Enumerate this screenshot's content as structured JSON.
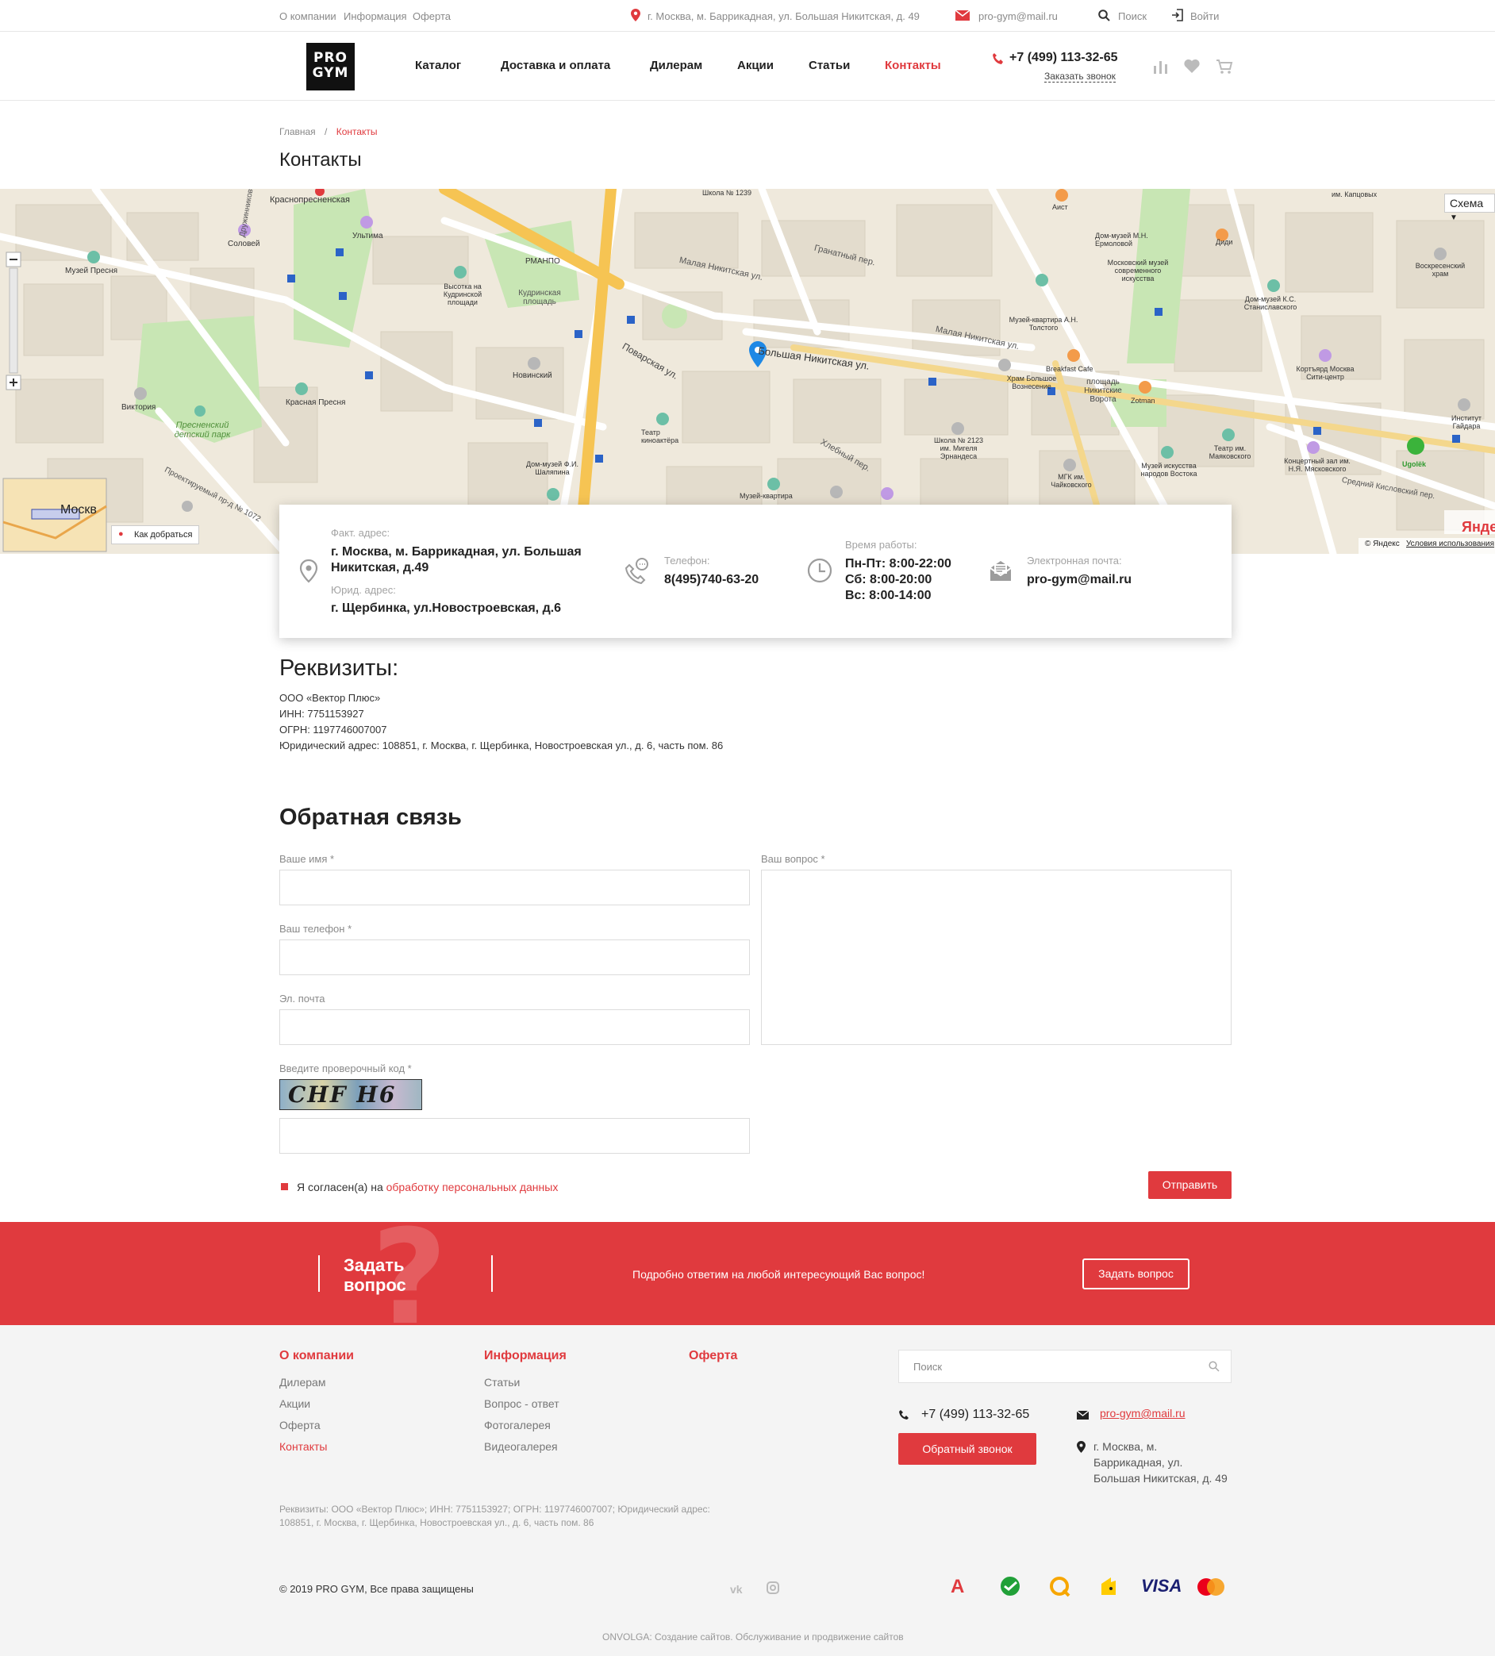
{
  "topbar": {
    "links": [
      "О компании",
      "Информация",
      "Оферта"
    ],
    "address": "г. Москва, м. Баррикадная, ул. Большая Никитская, д. 49",
    "email": "pro-gym@mail.ru",
    "search": "Поиск",
    "login": "Войти"
  },
  "header": {
    "logo_line1": "PRO",
    "logo_line2": "GYM",
    "nav": [
      "Каталог",
      "Доставка и оплата",
      "Дилерам",
      "Акции",
      "Статьи",
      "Контакты"
    ],
    "phone": "+7 (499) 113-32-65",
    "callback": "Заказать звонок"
  },
  "breadcrumb": {
    "home": "Главная",
    "sep": "/",
    "current": "Контакты"
  },
  "page_title": "Контакты",
  "map": {
    "scheme_button": "Схема",
    "route_label": "Как добраться",
    "minimap_label": "Москв",
    "copyright": "© Яндекс",
    "terms": "Условия использования",
    "yandex_logo": "Яндекс",
    "labels": {
      "street1": "Малая Никитская ул.",
      "street2": "Большая Никитская ул.",
      "street3": "Поварская ул.",
      "street4": "Гранатный пер.",
      "street5": "Хлебный пер.",
      "street6": "Малая Никитская ул.",
      "poi1": "Краснопресненская",
      "poi2": "Соловей",
      "poi3": "Музей Пресня",
      "poi4": "Ультима",
      "poi5": "Высотка на Кудринской площади",
      "poi6": "Кудринская площадь",
      "poi7": "РМАНПО",
      "poi8": "Новинский",
      "poi9": "Красная Пресня",
      "poi10": "Виктория",
      "poi11": "Пресненский детский парк",
      "poi12": "Театр киноактёра",
      "poi13": "Дом-музей Ф.И. Шаляпина",
      "poi14": "Музей-квартира А.Н. Толстого",
      "poi15": "Храм Большое Вознесение",
      "poi16": "Breakfast Cafe",
      "poi17": "площадь Никитские Ворота",
      "poi18": "Zotman",
      "poi19": "Дом-музей М.Н. Ермоловой",
      "poi20": "Московский музей современного искусства",
      "poi21": "Диди",
      "poi22": "Аист",
      "poi23": "Дом-музей К.С. Станиславского",
      "poi24": "Воскресенский храм",
      "poi25": "Кортъярд Москва Сити-центр",
      "poi26": "Институт Гайдара",
      "poi27": "Ugolёk",
      "poi28": "Театр им. Маяковского",
      "poi29": "Концертный зал им. Н.Я. Мясковского",
      "poi30": "Музей искусства народов Востока",
      "poi31": "МГК им. Чайковского",
      "poi32": "Школа № 2123 им. Мигеля Эрнандеса",
      "poi33": "Школа № 1239",
      "poi34": "Музей-квартира",
      "poi35": "им. Капцовых",
      "poi36": "Средний Кисловский пер.",
      "poi37": "Проектируемый пр-д № 1072",
      "poi38": "Дружинниковская ул."
    }
  },
  "contacts": {
    "fact_label": "Факт. адрес:",
    "fact_value": "г. Москва, м. Баррикадная, ул. Большая Никитская, д.49",
    "jur_label": "Юрид. адрес:",
    "jur_value": "г. Щербинка, ул.Новостроевская, д.6",
    "phone_label": "Телефон:",
    "phone_value": "8(495)740-63-20",
    "hours_label": "Время работы:",
    "hours": [
      "Пн-Пт: 8:00-22:00",
      "Сб: 8:00-20:00",
      "Вс: 8:00-14:00"
    ],
    "email_label": "Электронная почта:",
    "email_value": "pro-gym@mail.ru"
  },
  "requisites": {
    "title": "Реквизиты:",
    "lines": [
      "ООО «Вектор Плюс»",
      "ИНН: 7751153927",
      "ОГРН: 1197746007007",
      "Юридический адрес: 108851, г. Москва, г. Щербинка, Новостроевская ул., д. 6, часть пом. 86"
    ]
  },
  "feedback": {
    "title": "Обратная связь",
    "name_label": "Ваше имя *",
    "phone_label": "Ваш телефон *",
    "email_label": "Эл. почта",
    "question_label": "Ваш вопрос *",
    "captcha_label": "Введите проверочный код *",
    "captcha_text": "CHF H6",
    "agree_text": "Я согласен(а) на",
    "agree_link": "обработку персональных данных",
    "submit": "Отправить"
  },
  "banner": {
    "title_line1": "Задать",
    "title_line2": "вопрос",
    "text": "Подробно ответим на любой интересующий Вас вопрос!",
    "button": "Задать вопрос"
  },
  "footer": {
    "col1_title": "О компании",
    "col1_links": [
      "Дилерам",
      "Акции",
      "Оферта",
      "Контакты"
    ],
    "col2_title": "Информация",
    "col2_links": [
      "Статьи",
      "Вопрос - ответ",
      "Фотогалерея",
      "Видеогалерея"
    ],
    "col3_title": "Оферта",
    "search_placeholder": "Поиск",
    "phone": "+7 (499) 113-32-65",
    "callback_button": "Обратный звонок",
    "email": "pro-gym@mail.ru",
    "address": "г. Москва, м. Баррикадная, ул. Большая Никитская, д. 49",
    "requisites": "Реквизиты: ООО «Вектор Плюс»; ИНН: 7751153927; ОГРН: 1197746007007; Юридический адрес: 108851, г. Москва, г. Щербинка, Новостроевская ул., д. 6, часть пом. 86",
    "copyright": "© 2019 PRO GYM, Все права защищены",
    "payments": [
      "А",
      "Сбербанк",
      "Q",
      "Яндекс.Деньги",
      "VISA",
      "mastercard"
    ],
    "credit": "ONVOLGA: Создание сайтов. Обслуживание и продвижение сайтов"
  },
  "colors": {
    "accent": "#e03a3e",
    "map_bg": "#efe9dc",
    "park": "#c8e6b4",
    "footer_bg": "#f4f4f4"
  }
}
